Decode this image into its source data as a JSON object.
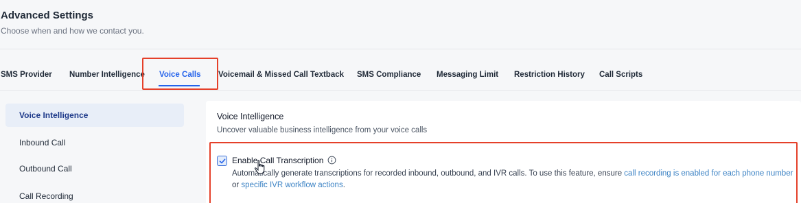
{
  "header": {
    "title": "Advanced Settings",
    "subtitle": "Choose when and how we contact you."
  },
  "tabs": [
    {
      "label": "SMS Provider"
    },
    {
      "label": "Number Intelligence"
    },
    {
      "label": "Voice Calls",
      "active": true
    },
    {
      "label": "Voicemail & Missed Call Textback"
    },
    {
      "label": "SMS Compliance"
    },
    {
      "label": "Messaging Limit"
    },
    {
      "label": "Restriction History"
    },
    {
      "label": "Call Scripts"
    }
  ],
  "sidebar": {
    "items": [
      {
        "label": "Voice Intelligence",
        "active": true
      },
      {
        "label": "Inbound Call"
      },
      {
        "label": "Outbound Call"
      },
      {
        "label": "Call Recording"
      }
    ]
  },
  "panel": {
    "title": "Voice Intelligence",
    "description": "Uncover valuable business intelligence from your voice calls",
    "option": {
      "label": "Enable Call Transcription",
      "checked": true,
      "desc_prefix": "Automatically generate transcriptions for recorded inbound, outbound, and IVR calls. To use this feature, ensure ",
      "link1": "call recording is enabled for each phone number",
      "desc_middle": " or ",
      "link2": "specific IVR workflow actions",
      "desc_suffix": "."
    }
  },
  "colors": {
    "accent": "#2563eb",
    "highlight": "#e5402a",
    "link": "#3b82c4"
  }
}
